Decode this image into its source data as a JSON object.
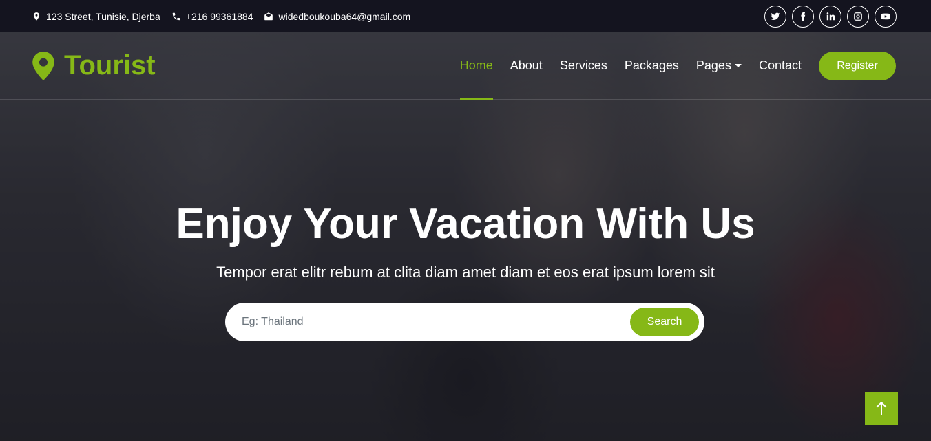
{
  "topbar": {
    "address": "123 Street, Tunisie, Djerba",
    "phone": "+216 99361884",
    "email": "widedboukouba64@gmail.com",
    "socials": [
      "twitter-icon",
      "facebook-icon",
      "linkedin-icon",
      "instagram-icon",
      "youtube-icon"
    ]
  },
  "brand": {
    "name": "Tourist",
    "icon": "map-marker-icon",
    "color": "#86b817"
  },
  "nav": {
    "items": [
      {
        "label": "Home",
        "active": true
      },
      {
        "label": "About"
      },
      {
        "label": "Services"
      },
      {
        "label": "Packages"
      },
      {
        "label": "Pages",
        "dropdown": true
      },
      {
        "label": "Contact"
      }
    ],
    "register_label": "Register"
  },
  "hero": {
    "title": "Enjoy Your Vacation With Us",
    "subtitle": "Tempor erat elitr rebum at clita diam amet diam et eos erat ipsum lorem sit"
  },
  "search": {
    "placeholder": "Eg: Thailand",
    "value": "",
    "button_label": "Search"
  },
  "back_to_top": {
    "icon": "arrow-up-icon"
  }
}
